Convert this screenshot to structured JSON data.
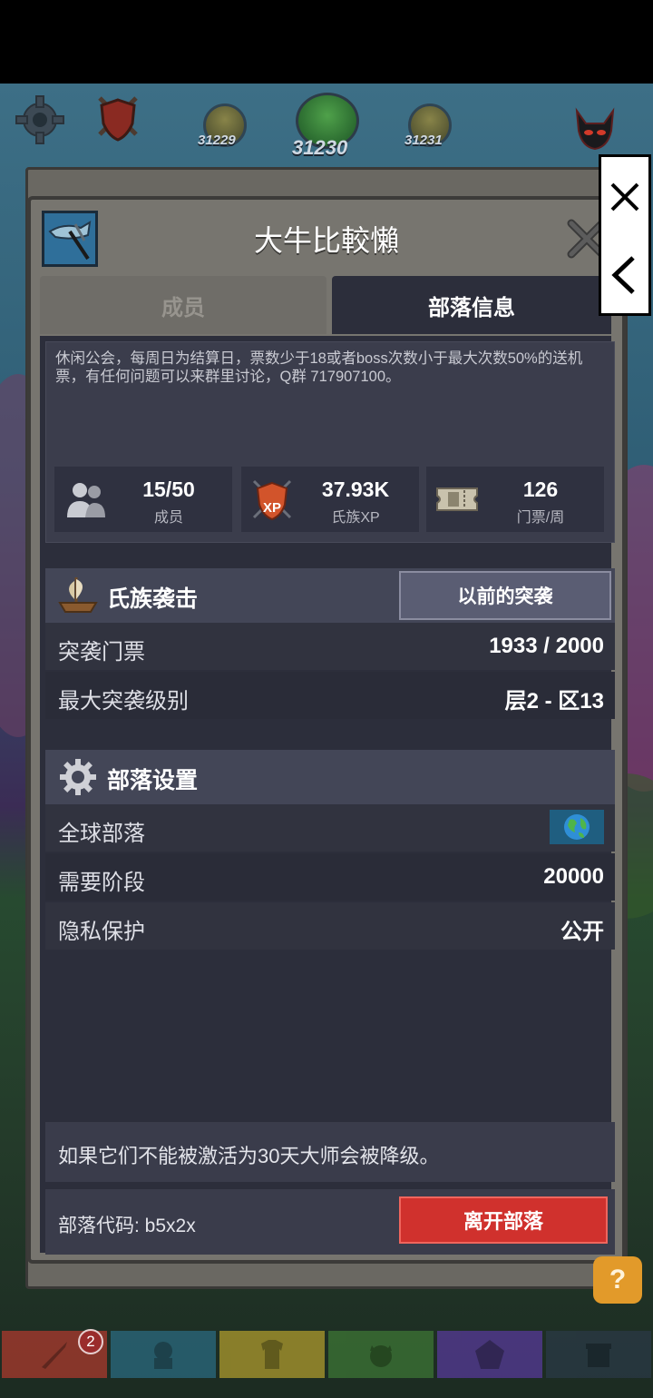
{
  "hud": {
    "stages": [
      {
        "label": "31229"
      },
      {
        "label": "31230"
      },
      {
        "label": "31231"
      }
    ]
  },
  "dialog": {
    "clan_name": "大牛比較懶",
    "tabs": [
      {
        "label": "成员",
        "active": false
      },
      {
        "label": "部落信息",
        "active": true
      }
    ],
    "description": "休闲公会，每周日为结算日，票数少于18或者boss次数小于最大次数50%的送机票，有任何问题可以来群里讨论，Q群 717907100。",
    "stats": [
      {
        "value": "15/50",
        "label": "成员",
        "icon": "members-icon"
      },
      {
        "value": "37.93K",
        "label": "氏族XP",
        "icon": "clan-xp-icon"
      },
      {
        "value": "126",
        "label": "门票/周",
        "icon": "ticket-icon"
      }
    ],
    "raid": {
      "title": "氏族袭击",
      "prev_button": "以前的突袭",
      "rows": [
        {
          "label": "突袭门票",
          "value": "1933 / 2000"
        },
        {
          "label": "最大突袭级别",
          "value": "层2 - 区13"
        }
      ]
    },
    "settings": {
      "title": "部落设置",
      "rows": [
        {
          "label": "全球部落",
          "value": "globe-icon"
        },
        {
          "label": "需要阶段",
          "value": "20000"
        },
        {
          "label": "隐私保护",
          "value": "公开"
        }
      ]
    },
    "notice": "如果它们不能被激活为30天大师会被降级。",
    "clan_code": "部落代码: b5x2x",
    "leave_button": "离开部落"
  },
  "overlay": {
    "close_icon": "close-icon",
    "back_icon": "chevron-left-icon"
  },
  "help_button": "?",
  "bottom_nav": {
    "badge": "2",
    "colors": [
      "#b53a2e",
      "#2b6d86",
      "#b7a12d",
      "#3f7a36",
      "#5a3aa0",
      "#2b3a48"
    ]
  }
}
